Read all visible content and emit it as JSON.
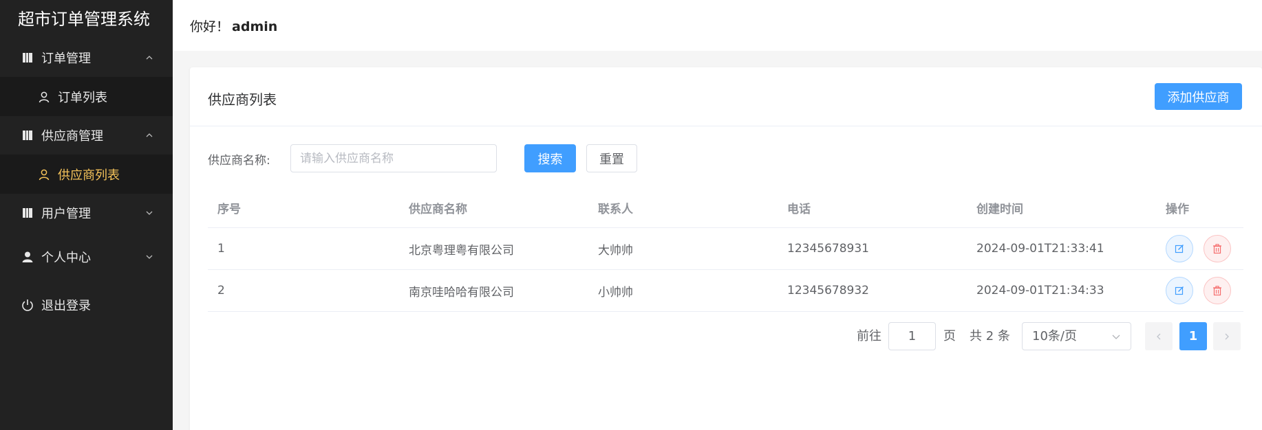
{
  "app": {
    "title": "超市订单管理系统"
  },
  "header": {
    "greeting": "你好！",
    "username": "admin"
  },
  "sidebar": {
    "items": [
      {
        "label": "订单管理",
        "icon": "book-icon",
        "expanded": true,
        "children": [
          {
            "label": "订单列表",
            "icon": "user-outline-icon",
            "active": false
          }
        ]
      },
      {
        "label": "供应商管理",
        "icon": "book-icon",
        "expanded": true,
        "children": [
          {
            "label": "供应商列表",
            "icon": "user-outline-icon",
            "active": true
          }
        ]
      },
      {
        "label": "用户管理",
        "icon": "book-icon",
        "expanded": false
      },
      {
        "label": "个人中心",
        "icon": "user-filled-icon",
        "expanded": false
      },
      {
        "label": "退出登录",
        "icon": "power-icon"
      }
    ]
  },
  "card": {
    "title": "供应商列表",
    "add_button": "添加供应商"
  },
  "search": {
    "label": "供应商名称:",
    "placeholder": "请输入供应商名称",
    "value": "",
    "search_button": "搜索",
    "reset_button": "重置"
  },
  "table": {
    "columns": [
      "序号",
      "供应商名称",
      "联系人",
      "电话",
      "创建时间",
      "操作"
    ],
    "rows": [
      [
        "1",
        "北京粤理粤有限公司",
        "大帅帅",
        "12345678931",
        "2024-09-01T21:33:41"
      ],
      [
        "2",
        "南京哇哈哈有限公司",
        "小帅帅",
        "12345678932",
        "2024-09-01T21:34:33"
      ]
    ]
  },
  "pagination": {
    "goto_prefix": "前往",
    "goto_value": "1",
    "goto_suffix": "页",
    "total_text": "共 2 条",
    "page_size": "10条/页",
    "current_page": "1"
  },
  "colors": {
    "primary": "#409eff",
    "sidebar_bg": "#222222",
    "active_menu": "#f5c35a",
    "danger": "#f56c6c"
  }
}
